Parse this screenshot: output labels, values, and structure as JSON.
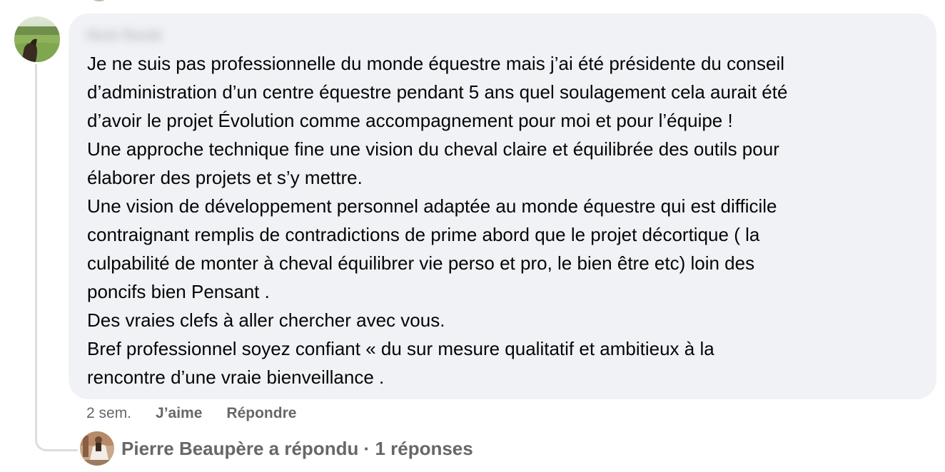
{
  "comment": {
    "author_name": "Nom flouté",
    "lines": [
      "Je ne suis pas professionnelle du monde équestre mais j’ai été présidente du conseil",
      "d’administration d’un centre équestre pendant 5 ans quel soulagement cela aurait été",
      "d’avoir le projet Évolution comme accompagnement pour moi et pour l’équipe !",
      "Une approche technique fine une vision du cheval claire et équilibrée des outils pour",
      "élaborer des projets et s’y mettre.",
      "Une vision de développement personnel adaptée au monde équestre qui est difficile",
      "contraignant remplis de contradictions de prime abord que le projet décortique ( la",
      "culpabilité de monter à cheval équilibrer vie perso et pro, le bien être etc) loin des",
      "poncifs bien Pensant .",
      "Des vraies clefs à aller chercher avec vous.",
      "Bref professionnel soyez confiant « du sur mesure qualitatif et ambitieux à la",
      "rencontre d’une vraie bienveillance ."
    ],
    "timestamp": "2 sem.",
    "like_label": "J’aime",
    "reply_label": "Répondre"
  },
  "reply_summary": {
    "text": "Pierre Beaupère a répondu · 1 réponses"
  },
  "icons": {
    "commenter_avatar": "avatar-photo-horse-field",
    "replier_avatar": "avatar-photo-horse-rider"
  },
  "colors": {
    "bubble_background": "#f0f2f5",
    "text_primary": "#050505",
    "text_secondary": "#65676b",
    "thread_line": "#dadde1"
  }
}
